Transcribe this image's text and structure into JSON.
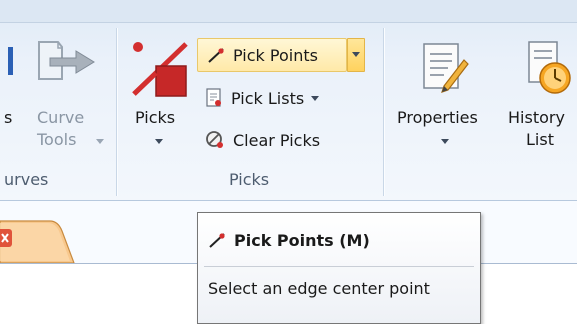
{
  "ribbon": {
    "partial_left_label": "s",
    "curve_tools": {
      "line1": "Curve",
      "line2": "Tools"
    },
    "left_group_label": "urves",
    "picks": {
      "button_label": "Picks",
      "pick_points": "Pick Points",
      "pick_lists": "Pick Lists",
      "clear_picks": "Clear Picks",
      "group_label": "Picks"
    },
    "properties_label": "Properties",
    "history_list": {
      "line1": "History",
      "line2": "List"
    }
  },
  "tooltip": {
    "title": "Pick Points (M)",
    "description": "Select an edge center point"
  },
  "icons": {
    "curve_tools": "curve-tools-icon",
    "picks": "picks-icon",
    "pick_points": "pick-points-icon",
    "pick_lists": "pick-lists-icon",
    "clear_picks": "clear-picks-icon",
    "properties": "properties-icon",
    "history": "history-list-icon",
    "tab_close": "tab-close-icon"
  },
  "colors": {
    "highlight": "#ffe9a8",
    "pick_red": "#d32f2f",
    "tab_orange": "#f2a34a"
  }
}
